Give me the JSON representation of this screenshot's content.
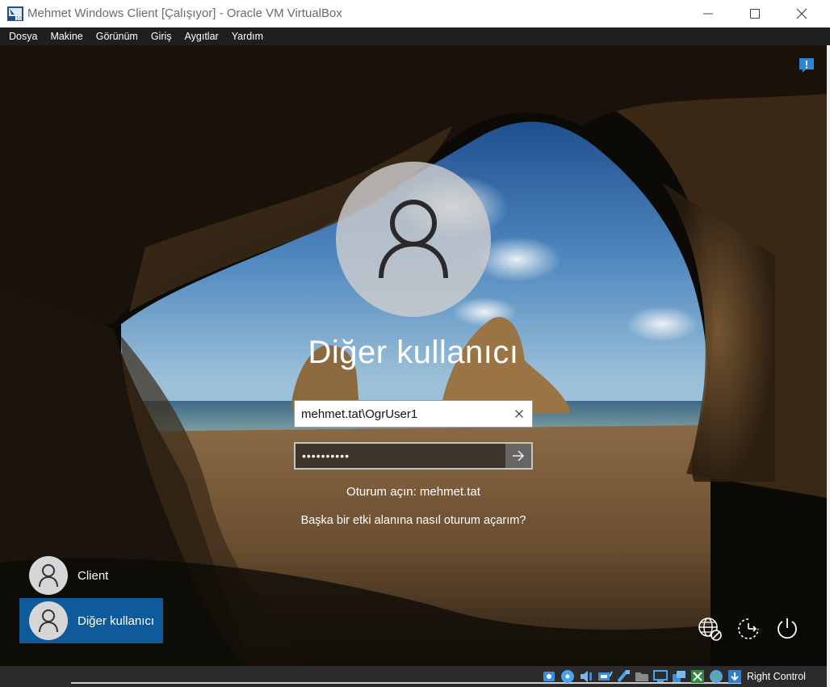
{
  "window": {
    "title": "Mehmet Windows Client [Çalışıyor] - Oracle VM VirtualBox",
    "controls": [
      "minimize",
      "maximize",
      "close"
    ]
  },
  "menu": {
    "items": [
      {
        "label": "Dosya"
      },
      {
        "label": "Makine"
      },
      {
        "label": "Görünüm"
      },
      {
        "label": "Giriş"
      },
      {
        "label": "Aygıtlar"
      },
      {
        "label": "Yardım"
      }
    ]
  },
  "login": {
    "user_title": "Diğer kullanıcı",
    "username_value": "mehmet.tat\\OgrUser1",
    "password_value": "••••••••••",
    "signin_domain": "Oturum açın: mehmet.tat",
    "other_domain_link": "Başka bir etki alanına nasıl oturum açarım?"
  },
  "user_tiles": [
    {
      "label": "Client",
      "selected": false
    },
    {
      "label": "Diğer kullanıcı",
      "selected": true
    }
  ],
  "bottom_icons": [
    "network-icon",
    "ease-of-access-icon",
    "power-icon"
  ],
  "statusbar": {
    "host_key": "Right Control",
    "icons": [
      "hard-disk-icon",
      "optical-drive-icon",
      "audio-icon",
      "network-adapter-icon",
      "usb-icon",
      "shared-folders-icon",
      "display-icon",
      "video-capture-icon",
      "virtualization-icon",
      "mouse-integration-icon",
      "keyboard-capture-icon"
    ]
  },
  "colors": {
    "selected_tile": "#0f5a9a",
    "menubar": "#1f1f1f",
    "statusbar": "#2b2b2b"
  }
}
